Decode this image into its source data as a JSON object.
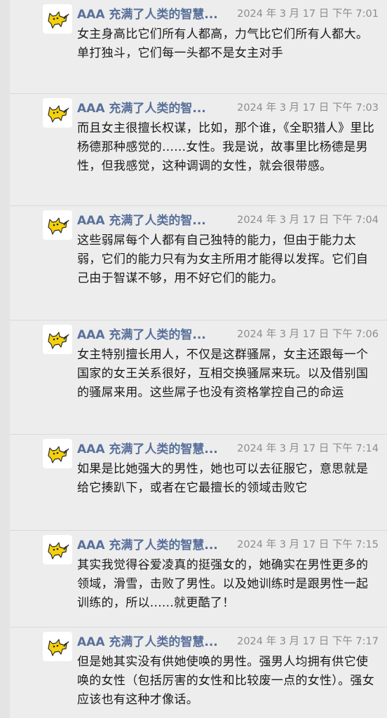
{
  "messages": [
    {
      "sender": "AAA 充满了人类的智慧...",
      "time": "2024 年 3 月 17 日 下午 7:01",
      "text": "女主身高比它们所有人都高，力气比它们所有人都大。单打独斗，它们每一头都不是女主对手"
    },
    {
      "sender": "AAA 充满了人类的智...",
      "time": "2024 年 3 月 17 日 下午 7:03",
      "text": "而且女主很擅长权谋，比如，那个谁，《全职猎人》里比杨德那种感觉的......女性。我是说，故事里比杨德是男性，但我感觉，这种调调的女性，就会很带感。"
    },
    {
      "sender": "AAA 充满了人类的智...",
      "time": "2024 年 3 月 17 日 下午 7:04",
      "text": "这些弱屌每个人都有自己独特的能力，但由于能力太弱，它们的能力只有为女主所用才能得以发挥。它们自己由于智谋不够，用不好它们的能力。"
    },
    {
      "sender": "AAA 充满了人类的智...",
      "time": "2024 年 3 月 17 日 下午 7:06",
      "text": "女主特别擅长用人，不仅是这群骚屌，女主还跟每一个国家的女王关系很好，互相交换骚屌来玩。以及借别国的骚屌来用。这些屌子也没有资格掌控自己的命运"
    },
    {
      "sender": "AAA 充满了人类的智慧...",
      "time": "2024 年 3 月 17 日 下午 7:14",
      "text": "如果是比她强大的男性，她也可以去征服它，意思就是给它揍趴下，或者在它最擅长的领域击败它"
    },
    {
      "sender": "AAA 充满了人类的智慧...",
      "time": "2024 年 3 月 17 日 下午 7:15",
      "text": "其实我觉得谷爱凌真的挺强女的，她确实在男性更多的领域，滑雪，击败了男性。以及她训练时是跟男性一起训练的，所以......就更酷了！"
    },
    {
      "sender": "AAA 充满了人类的智慧...",
      "time": "2024 年 3 月 17 日 下午 7:17",
      "text": "但是她其实没有供她使唤的男性。强男人均拥有供它使唤的女性（包括厉害的女性和比较废一点的女性）。强女应该也有这种才像话。"
    }
  ],
  "colors": {
    "sender": "#58709a",
    "time": "#8c8c8c",
    "text": "#191919",
    "background": "#ededed"
  },
  "icons": {
    "avatar": "yellow-cat-avatar-icon"
  }
}
